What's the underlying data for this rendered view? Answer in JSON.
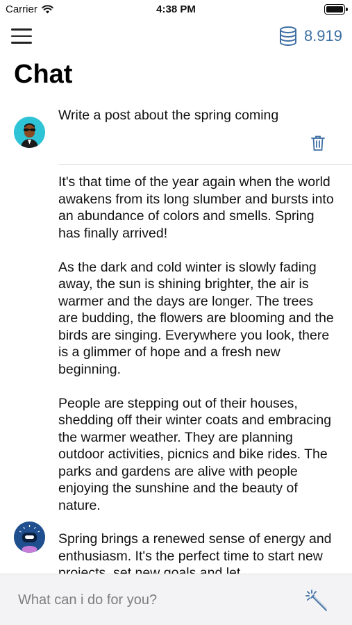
{
  "status_bar": {
    "carrier": "Carrier",
    "time": "4:38 PM"
  },
  "header": {
    "credits": "8.919",
    "title": "Chat"
  },
  "messages": {
    "user_prompt": "Write a post about the spring coming",
    "response_text": "It's that time of the year again when the world awakens from its long slumber and bursts into an abundance of colors and smells. Spring has finally arrived!\n\nAs the dark and cold winter is slowly fading away, the sun is shining brighter, the air is warmer and the days are longer. The trees are budding, the flowers are blooming and the birds are singing. Everywhere you look, there is a glimmer of hope and a fresh new beginning.\n\nPeople are stepping out of their houses, shedding off their winter coats and embracing the warmer weather. They are planning outdoor activities, picnics and bike rides. The parks and gardens are alive with people enjoying the sunshine and the beauty of nature.",
    "response_text_2": "Spring brings a renewed sense of energy and enthusiasm. It's the perfect time to start new projects, set new goals and let"
  },
  "input": {
    "placeholder": "What can i do for you?"
  },
  "colors": {
    "accent": "#3e6fa3",
    "user_avatar_bg": "#2ec4d6",
    "bot_avatar_bg": "#1f4f8f"
  },
  "icons": {
    "menu": "hamburger-icon",
    "credits": "coins-stack-icon",
    "delete": "trash-icon",
    "send": "magic-wand-icon"
  }
}
